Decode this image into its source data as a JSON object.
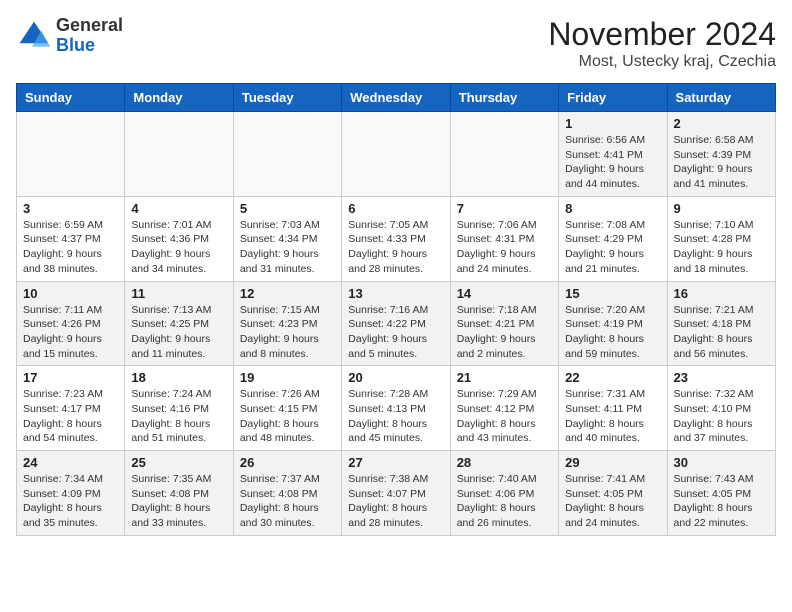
{
  "logo": {
    "general": "General",
    "blue": "Blue"
  },
  "title": {
    "month": "November 2024",
    "location": "Most, Ustecky kraj, Czechia"
  },
  "weekdays": [
    "Sunday",
    "Monday",
    "Tuesday",
    "Wednesday",
    "Thursday",
    "Friday",
    "Saturday"
  ],
  "weeks": [
    [
      {
        "day": "",
        "info": ""
      },
      {
        "day": "",
        "info": ""
      },
      {
        "day": "",
        "info": ""
      },
      {
        "day": "",
        "info": ""
      },
      {
        "day": "",
        "info": ""
      },
      {
        "day": "1",
        "info": "Sunrise: 6:56 AM\nSunset: 4:41 PM\nDaylight: 9 hours and 44 minutes."
      },
      {
        "day": "2",
        "info": "Sunrise: 6:58 AM\nSunset: 4:39 PM\nDaylight: 9 hours and 41 minutes."
      }
    ],
    [
      {
        "day": "3",
        "info": "Sunrise: 6:59 AM\nSunset: 4:37 PM\nDaylight: 9 hours and 38 minutes."
      },
      {
        "day": "4",
        "info": "Sunrise: 7:01 AM\nSunset: 4:36 PM\nDaylight: 9 hours and 34 minutes."
      },
      {
        "day": "5",
        "info": "Sunrise: 7:03 AM\nSunset: 4:34 PM\nDaylight: 9 hours and 31 minutes."
      },
      {
        "day": "6",
        "info": "Sunrise: 7:05 AM\nSunset: 4:33 PM\nDaylight: 9 hours and 28 minutes."
      },
      {
        "day": "7",
        "info": "Sunrise: 7:06 AM\nSunset: 4:31 PM\nDaylight: 9 hours and 24 minutes."
      },
      {
        "day": "8",
        "info": "Sunrise: 7:08 AM\nSunset: 4:29 PM\nDaylight: 9 hours and 21 minutes."
      },
      {
        "day": "9",
        "info": "Sunrise: 7:10 AM\nSunset: 4:28 PM\nDaylight: 9 hours and 18 minutes."
      }
    ],
    [
      {
        "day": "10",
        "info": "Sunrise: 7:11 AM\nSunset: 4:26 PM\nDaylight: 9 hours and 15 minutes."
      },
      {
        "day": "11",
        "info": "Sunrise: 7:13 AM\nSunset: 4:25 PM\nDaylight: 9 hours and 11 minutes."
      },
      {
        "day": "12",
        "info": "Sunrise: 7:15 AM\nSunset: 4:23 PM\nDaylight: 9 hours and 8 minutes."
      },
      {
        "day": "13",
        "info": "Sunrise: 7:16 AM\nSunset: 4:22 PM\nDaylight: 9 hours and 5 minutes."
      },
      {
        "day": "14",
        "info": "Sunrise: 7:18 AM\nSunset: 4:21 PM\nDaylight: 9 hours and 2 minutes."
      },
      {
        "day": "15",
        "info": "Sunrise: 7:20 AM\nSunset: 4:19 PM\nDaylight: 8 hours and 59 minutes."
      },
      {
        "day": "16",
        "info": "Sunrise: 7:21 AM\nSunset: 4:18 PM\nDaylight: 8 hours and 56 minutes."
      }
    ],
    [
      {
        "day": "17",
        "info": "Sunrise: 7:23 AM\nSunset: 4:17 PM\nDaylight: 8 hours and 54 minutes."
      },
      {
        "day": "18",
        "info": "Sunrise: 7:24 AM\nSunset: 4:16 PM\nDaylight: 8 hours and 51 minutes."
      },
      {
        "day": "19",
        "info": "Sunrise: 7:26 AM\nSunset: 4:15 PM\nDaylight: 8 hours and 48 minutes."
      },
      {
        "day": "20",
        "info": "Sunrise: 7:28 AM\nSunset: 4:13 PM\nDaylight: 8 hours and 45 minutes."
      },
      {
        "day": "21",
        "info": "Sunrise: 7:29 AM\nSunset: 4:12 PM\nDaylight: 8 hours and 43 minutes."
      },
      {
        "day": "22",
        "info": "Sunrise: 7:31 AM\nSunset: 4:11 PM\nDaylight: 8 hours and 40 minutes."
      },
      {
        "day": "23",
        "info": "Sunrise: 7:32 AM\nSunset: 4:10 PM\nDaylight: 8 hours and 37 minutes."
      }
    ],
    [
      {
        "day": "24",
        "info": "Sunrise: 7:34 AM\nSunset: 4:09 PM\nDaylight: 8 hours and 35 minutes."
      },
      {
        "day": "25",
        "info": "Sunrise: 7:35 AM\nSunset: 4:08 PM\nDaylight: 8 hours and 33 minutes."
      },
      {
        "day": "26",
        "info": "Sunrise: 7:37 AM\nSunset: 4:08 PM\nDaylight: 8 hours and 30 minutes."
      },
      {
        "day": "27",
        "info": "Sunrise: 7:38 AM\nSunset: 4:07 PM\nDaylight: 8 hours and 28 minutes."
      },
      {
        "day": "28",
        "info": "Sunrise: 7:40 AM\nSunset: 4:06 PM\nDaylight: 8 hours and 26 minutes."
      },
      {
        "day": "29",
        "info": "Sunrise: 7:41 AM\nSunset: 4:05 PM\nDaylight: 8 hours and 24 minutes."
      },
      {
        "day": "30",
        "info": "Sunrise: 7:43 AM\nSunset: 4:05 PM\nDaylight: 8 hours and 22 minutes."
      }
    ]
  ]
}
